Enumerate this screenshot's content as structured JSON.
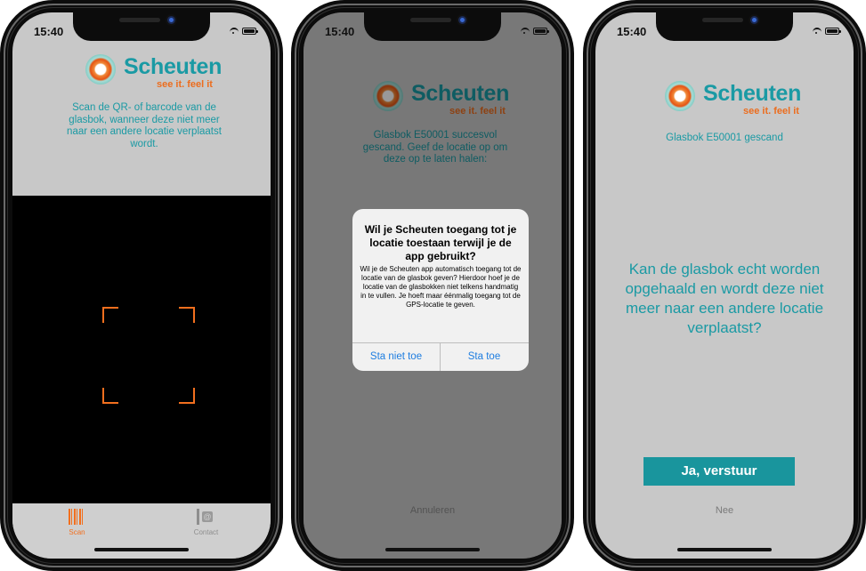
{
  "status_bar": {
    "time": "15:40"
  },
  "brand": {
    "name": "Scheuten",
    "tagline": "see it. feel it"
  },
  "screen1": {
    "instruction": "Scan de QR- of barcode van de glasbok, wanneer deze niet meer naar een andere locatie verplaatst wordt.",
    "tabs": [
      {
        "label": "Scan",
        "icon": "barcode-icon",
        "active": true
      },
      {
        "label": "Contact",
        "icon": "contact-icon",
        "active": false
      }
    ]
  },
  "screen2": {
    "message": "Glasbok E50001 succesvol gescand. Geef de locatie op om deze op te laten halen:",
    "cancel_label": "Annuleren",
    "alert": {
      "title": "Wil je Scheuten toegang tot je locatie toestaan terwijl je de app gebruikt?",
      "message": "Wil je de Scheuten app automatisch toegang tot de locatie van de glasbok geven? Hierdoor hoef je de locatie van de glasbokken niet telkens handmatig in te vullen. Je hoeft maar éénmalig toegang tot de GPS-locatie te geven.",
      "deny_label": "Sta niet toe",
      "allow_label": "Sta toe"
    }
  },
  "screen3": {
    "scanned": "Glasbok E50001 gescand",
    "question": "Kan de glasbok echt worden opgehaald en wordt deze niet meer naar een andere locatie verplaatst?",
    "confirm_label": "Ja, verstuur",
    "decline_label": "Nee"
  },
  "colors": {
    "brand_teal": "#1a9aa4",
    "brand_orange": "#f26f1e",
    "button_teal": "#19959d",
    "ios_blue": "#1e7de0"
  }
}
